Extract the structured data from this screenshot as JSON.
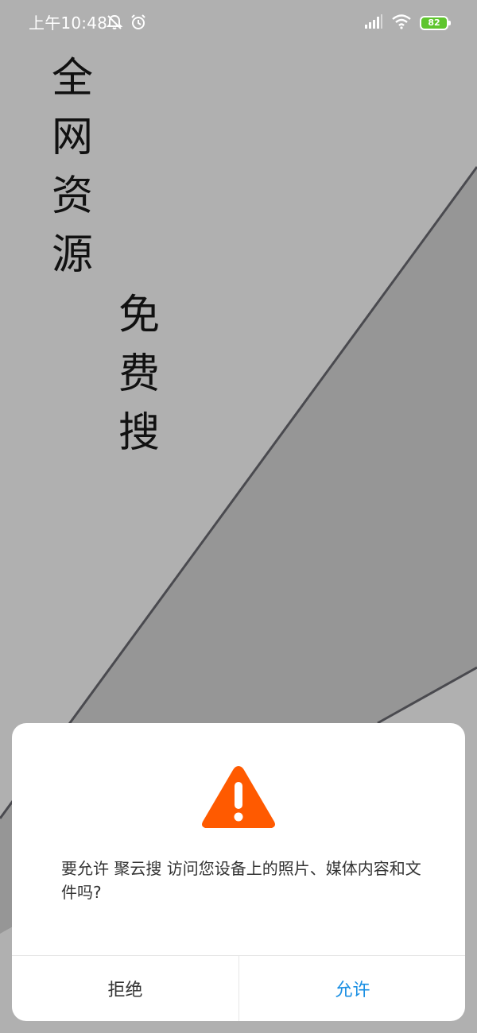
{
  "status_bar": {
    "time": "上午10:48",
    "battery_level": "82",
    "icons": [
      "notifications-off-icon",
      "alarm-icon",
      "signal-icon",
      "wifi-icon",
      "battery-icon"
    ]
  },
  "splash": {
    "slogan_line_1": [
      "全",
      "网",
      "资",
      "源"
    ],
    "slogan_line_2": [
      "免",
      "费",
      "搜"
    ]
  },
  "permission_dialog": {
    "icon": "warning-icon",
    "message": "要允许 聚云搜 访问您设备上的照片、媒体内容和文件吗?",
    "deny_label": "拒绝",
    "allow_label": "允许"
  },
  "colors": {
    "background": "#b0b0b0",
    "shape_dark": "#969696",
    "warning": "#ff5a00",
    "allow": "#1a8fe3",
    "battery": "#5fc52e"
  }
}
